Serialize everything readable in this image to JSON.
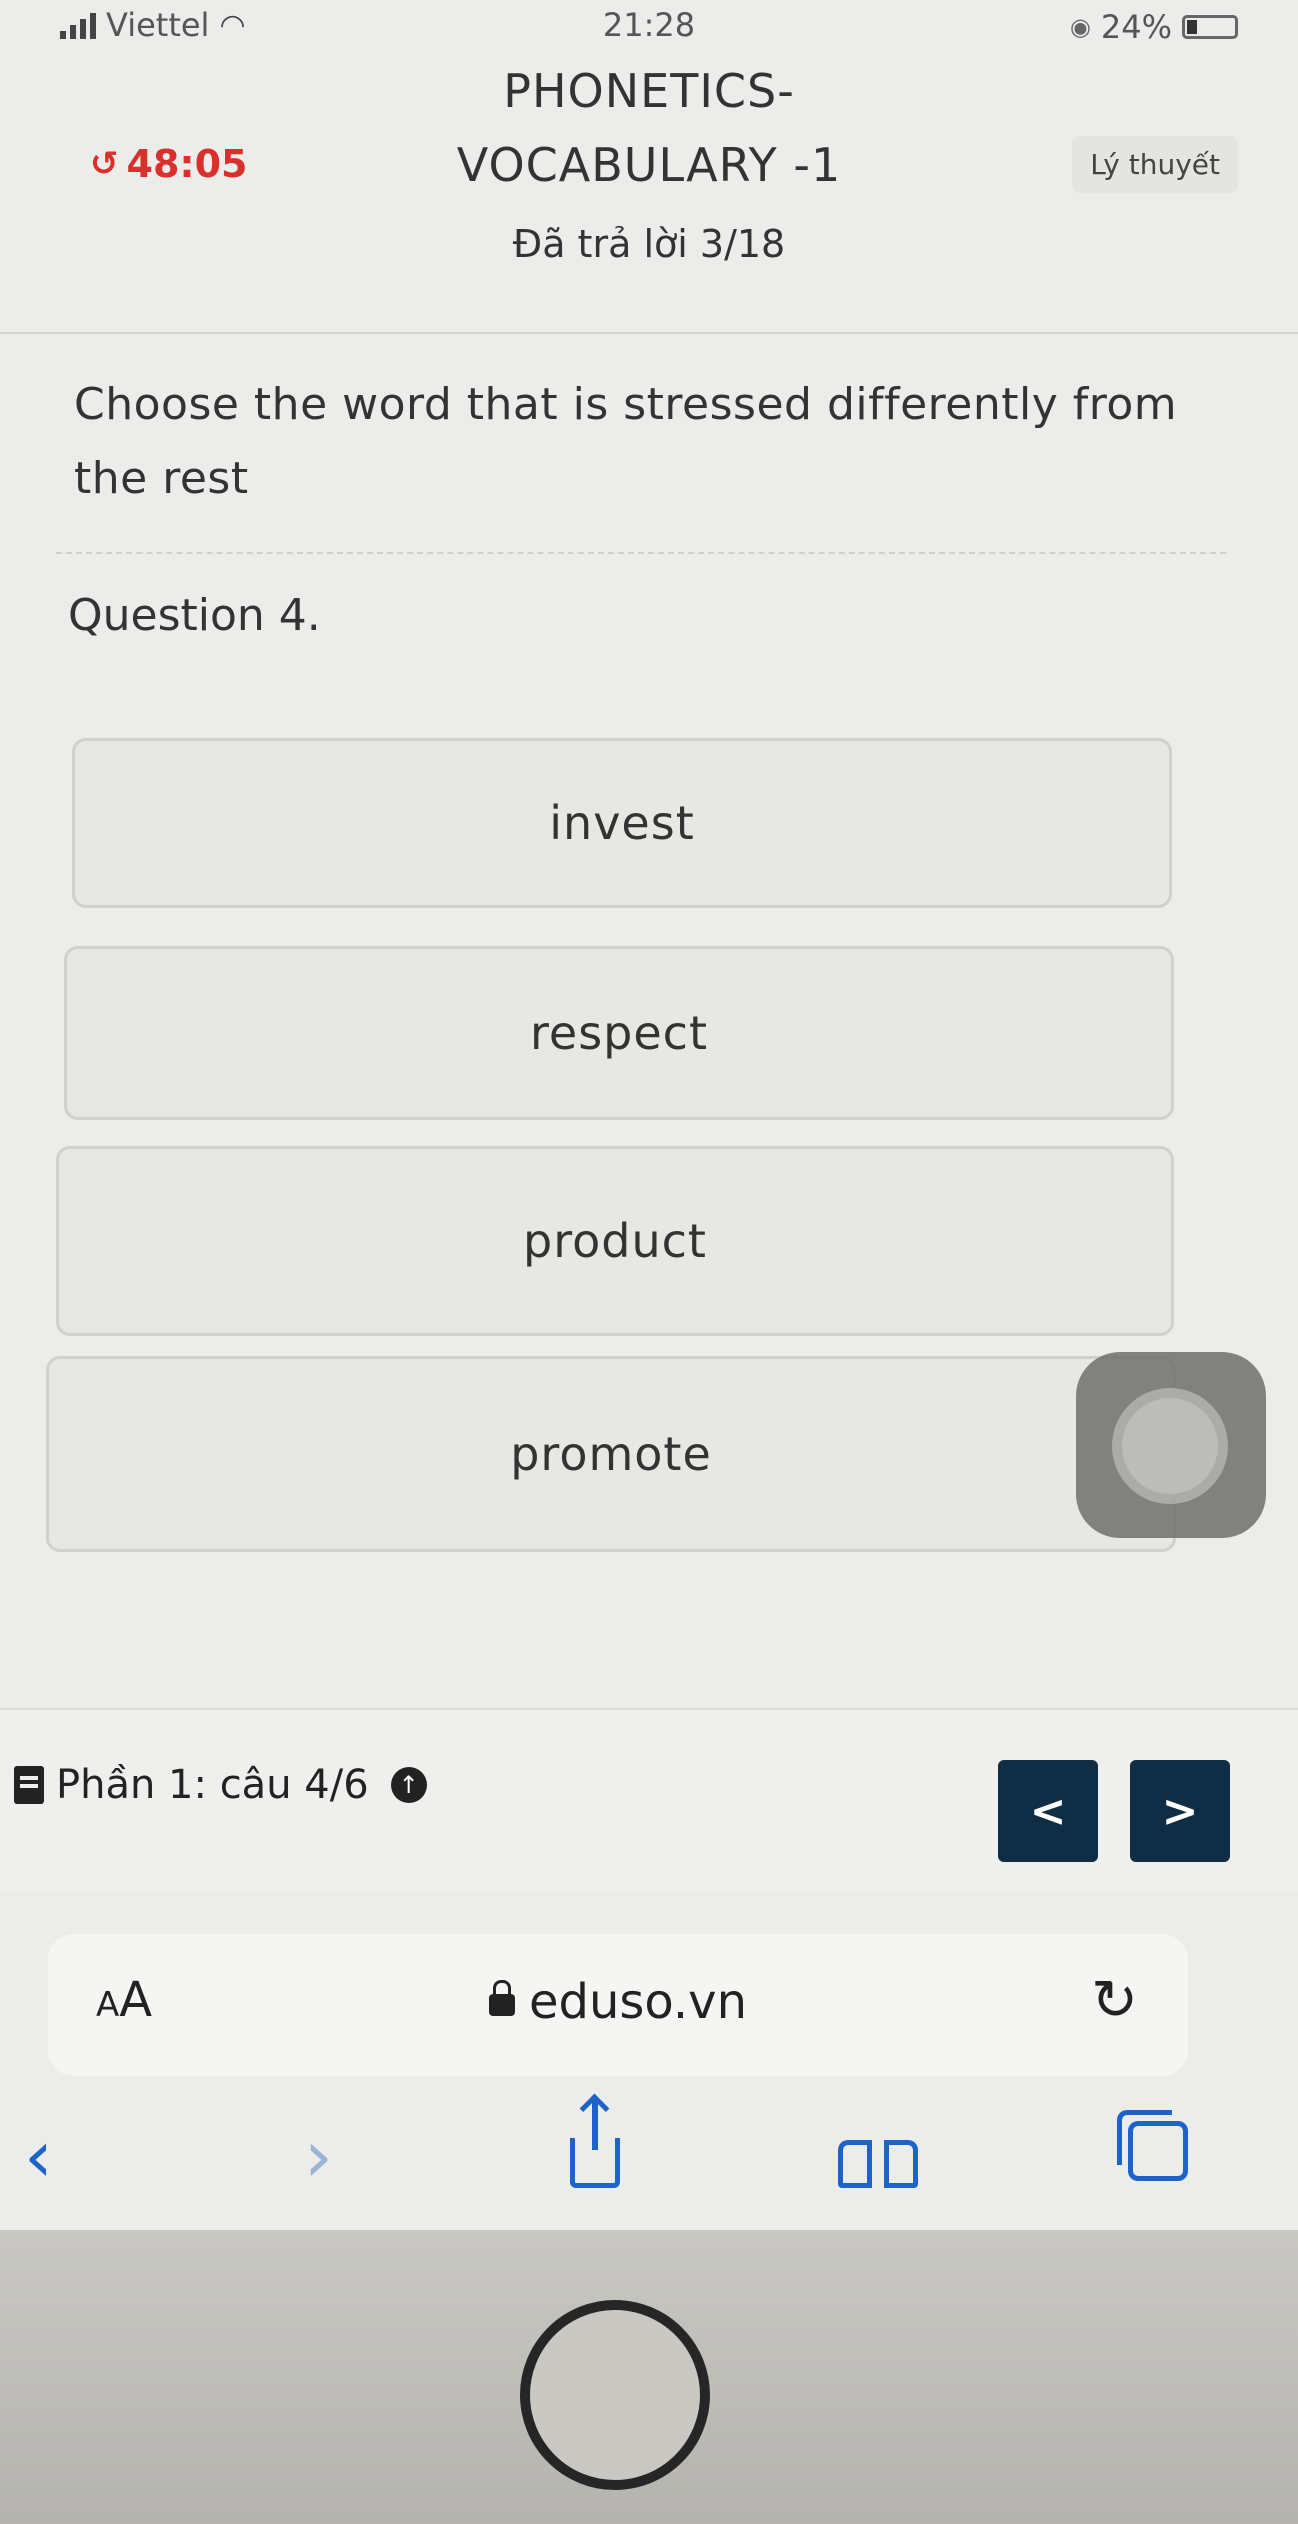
{
  "status_bar": {
    "carrier": "Viettel",
    "time": "21:28",
    "battery": "24%"
  },
  "header": {
    "title_line1": "PHONETICS-",
    "title_line2": "VOCABULARY -1",
    "timer": "48:05",
    "theory_label": "Lý thuyết",
    "answered": "Đã trả lời 3/18"
  },
  "question": {
    "instruction": "Choose the word that is stressed differently from the rest",
    "label": "Question 4.",
    "options": [
      "invest",
      "respect",
      "product",
      "promote"
    ]
  },
  "section": {
    "label": "Phần 1: câu 4/6",
    "prev": "<",
    "next": ">"
  },
  "browser": {
    "aa_label_small": "A",
    "aa_label_big": "A",
    "url": "eduso.vn"
  },
  "icons": {
    "back": "chevron-left-icon",
    "forward": "chevron-right-icon",
    "share": "share-icon",
    "bookmarks": "book-open-icon",
    "tabs": "tabs-icon"
  },
  "colors": {
    "timer": "#d9302c",
    "nav_button": "#0f2d44",
    "safari_blue": "#1e63c8"
  }
}
